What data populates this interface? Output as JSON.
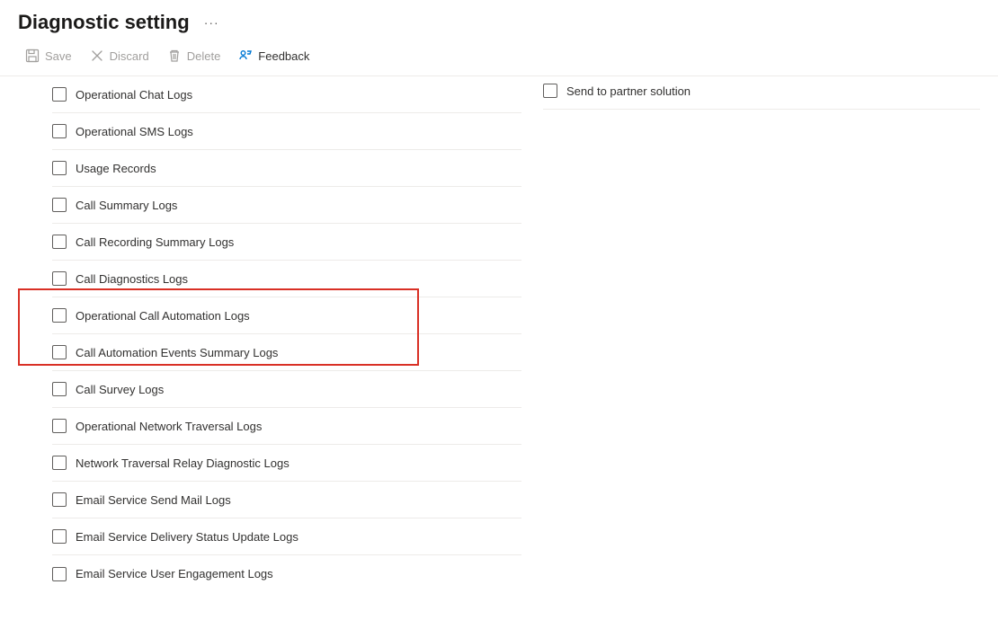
{
  "header": {
    "title": "Diagnostic setting",
    "more_label": "···"
  },
  "toolbar": {
    "save_label": "Save",
    "discard_label": "Discard",
    "delete_label": "Delete",
    "feedback_label": "Feedback"
  },
  "logs": {
    "items": [
      {
        "id": "operational-chat-logs",
        "label": "Operational Chat Logs"
      },
      {
        "id": "operational-sms-logs",
        "label": "Operational SMS Logs"
      },
      {
        "id": "usage-records",
        "label": "Usage Records"
      },
      {
        "id": "call-summary-logs",
        "label": "Call Summary Logs"
      },
      {
        "id": "call-recording-summary-logs",
        "label": "Call Recording Summary Logs"
      },
      {
        "id": "call-diagnostics-logs",
        "label": "Call Diagnostics Logs"
      },
      {
        "id": "operational-call-automation-logs",
        "label": "Operational Call Automation Logs"
      },
      {
        "id": "call-automation-events-summary-logs",
        "label": "Call Automation Events Summary Logs"
      },
      {
        "id": "call-survey-logs",
        "label": "Call Survey Logs"
      },
      {
        "id": "operational-network-traversal-logs",
        "label": "Operational Network Traversal Logs"
      },
      {
        "id": "network-traversal-relay-diagnostic-logs",
        "label": "Network Traversal Relay Diagnostic Logs"
      },
      {
        "id": "email-service-send-mail-logs",
        "label": "Email Service Send Mail Logs"
      },
      {
        "id": "email-service-delivery-status-update-logs",
        "label": "Email Service Delivery Status Update Logs"
      },
      {
        "id": "email-service-user-engagement-logs",
        "label": "Email Service User Engagement Logs"
      }
    ]
  },
  "destination": {
    "partner_label": "Send to partner solution"
  }
}
